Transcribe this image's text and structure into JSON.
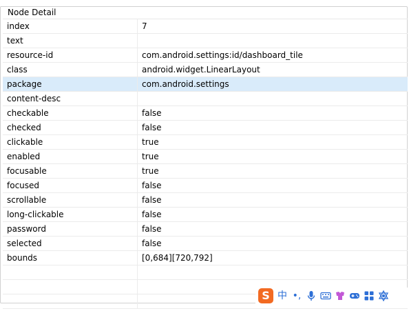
{
  "panel": {
    "title": "Node Detail"
  },
  "rows": [
    {
      "key": "index",
      "value": "7"
    },
    {
      "key": "text",
      "value": ""
    },
    {
      "key": "resource-id",
      "value": "com.android.settings:id/dashboard_tile"
    },
    {
      "key": "class",
      "value": "android.widget.LinearLayout"
    },
    {
      "key": "package",
      "value": "com.android.settings"
    },
    {
      "key": "content-desc",
      "value": ""
    },
    {
      "key": "checkable",
      "value": "false"
    },
    {
      "key": "checked",
      "value": "false"
    },
    {
      "key": "clickable",
      "value": "true"
    },
    {
      "key": "enabled",
      "value": "true"
    },
    {
      "key": "focusable",
      "value": "true"
    },
    {
      "key": "focused",
      "value": "false"
    },
    {
      "key": "scrollable",
      "value": "false"
    },
    {
      "key": "long-clickable",
      "value": "false"
    },
    {
      "key": "password",
      "value": "false"
    },
    {
      "key": "selected",
      "value": "false"
    },
    {
      "key": "bounds",
      "value": "[0,684][720,792]"
    },
    {
      "key": "",
      "value": ""
    },
    {
      "key": "",
      "value": ""
    },
    {
      "key": "",
      "value": ""
    }
  ],
  "selected_row": 4,
  "ime_toolbar": {
    "logo": "S",
    "mode": "中",
    "punct": "•,",
    "icons": [
      "microphone-icon",
      "keyboard-icon",
      "skin-icon",
      "gamepad-icon",
      "toolbox-icon",
      "settings-icon"
    ]
  },
  "colors": {
    "selection": "#d9ebfa",
    "ime_logo": "#f26a22",
    "ime_accent": "#2d6fd6"
  }
}
